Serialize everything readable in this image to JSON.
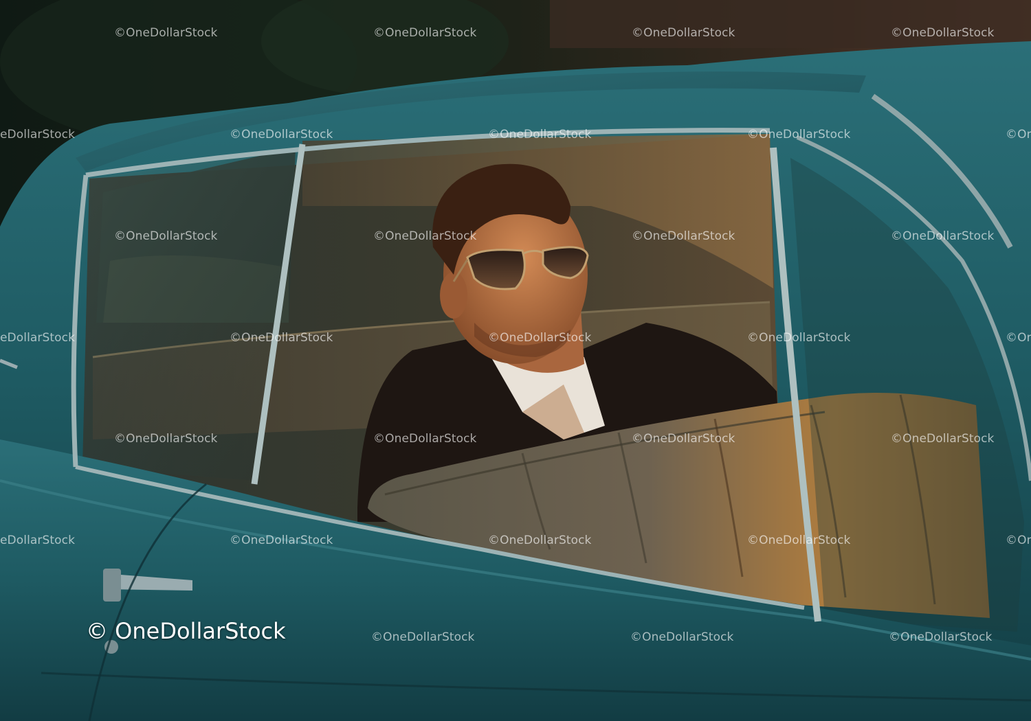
{
  "watermark": {
    "text": "©OneDollarStock",
    "truncated_left": "eDollarStock",
    "truncated_right": "©On"
  },
  "signature": {
    "text": "© OneDollarStock"
  },
  "colors": {
    "car_body": "#1f5b63",
    "car_body_dark": "#123c43",
    "chrome": "#8fa6a8",
    "leather": "#6b5230",
    "leather_lit": "#c08a45",
    "jacket": "#1c1512",
    "skin": "#b87548",
    "hair": "#3a2012"
  }
}
